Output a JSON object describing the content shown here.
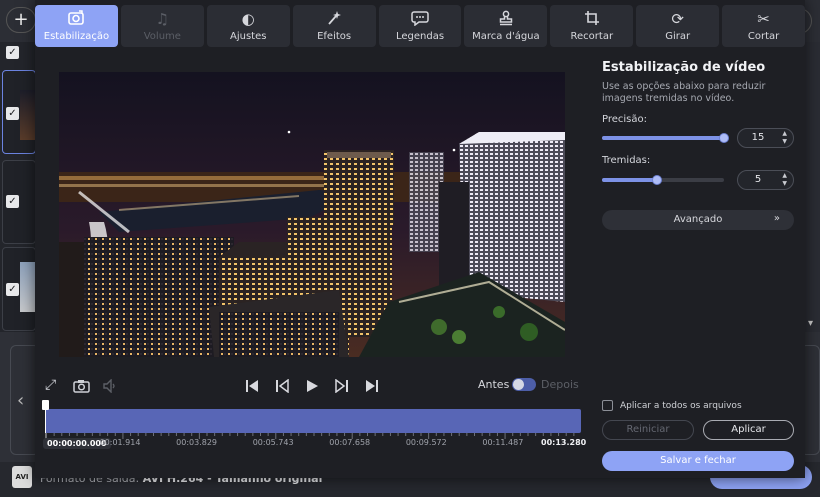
{
  "toolbar": {
    "tabs": [
      {
        "label": "Estabilização",
        "icon": "stabilize-icon",
        "state": "active"
      },
      {
        "label": "Volume",
        "icon": "music-note-icon",
        "state": "disabled"
      },
      {
        "label": "Ajustes",
        "icon": "contrast-icon",
        "state": "normal"
      },
      {
        "label": "Efeitos",
        "icon": "magic-wand-icon",
        "state": "normal"
      },
      {
        "label": "Legendas",
        "icon": "speech-bubble-icon",
        "state": "normal"
      },
      {
        "label": "Marca d'água",
        "icon": "stamp-icon",
        "state": "normal"
      },
      {
        "label": "Recortar",
        "icon": "crop-icon",
        "state": "normal"
      },
      {
        "label": "Girar",
        "icon": "rotate-icon",
        "state": "normal"
      },
      {
        "label": "Cortar",
        "icon": "scissors-icon",
        "state": "normal"
      }
    ]
  },
  "player": {
    "before_label": "Antes",
    "after_label": "Depois"
  },
  "timeline": {
    "timestamps": [
      "00:00:00.000",
      "00:01.914",
      "00:03.829",
      "00:05.743",
      "00:07.658",
      "00:09.572",
      "00:11.487",
      "00:13.280"
    ],
    "playhead_fraction": 0
  },
  "panel": {
    "title": "Estabilização de vídeo",
    "description": "Use as opções abaixo para reduzir imagens tremidas no vídeo.",
    "precision_label": "Precisão:",
    "precision_value": "15",
    "precision_fraction": 1.0,
    "tremor_label": "Tremidas:",
    "tremor_value": "5",
    "tremor_fraction": 0.45,
    "advanced_label": "Avançado",
    "apply_all_label": "Aplicar a todos os arquivos",
    "reset_label": "Reiniciar",
    "apply_label": "Aplicar",
    "save_close_label": "Salvar e fechar"
  },
  "background": {
    "output_format_prefix": "Formato de saída:",
    "output_format_value": "AVI H.264 - Tamanho original",
    "avi_badge": "AVI"
  },
  "colors": {
    "accent": "#8ea3f5",
    "timeline": "#5866b6",
    "dialog_bg": "#1e1f24"
  }
}
